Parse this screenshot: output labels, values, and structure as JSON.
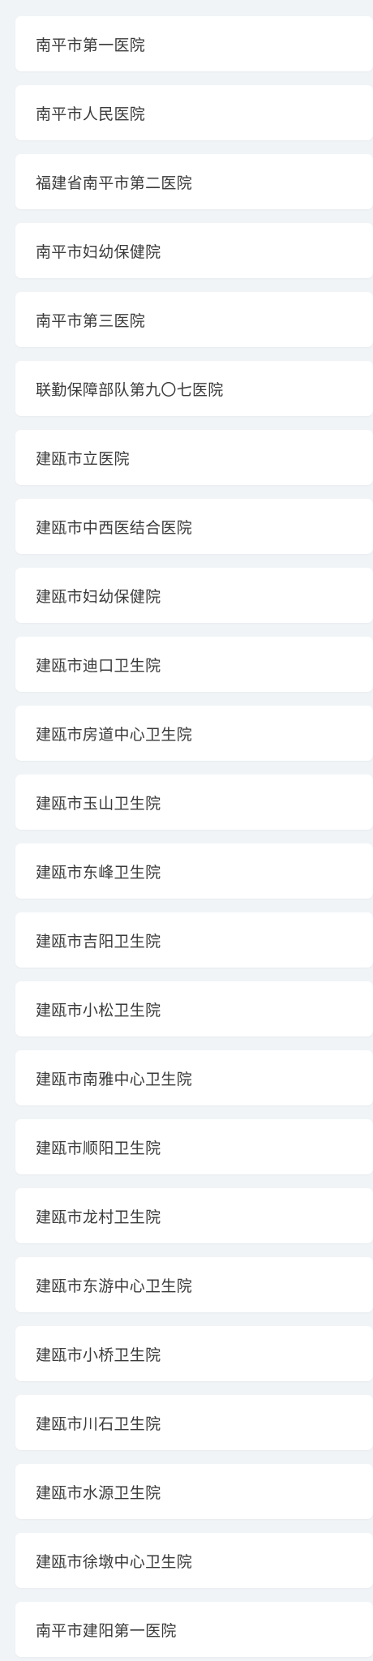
{
  "hospitals": [
    "南平市第一医院",
    "南平市人民医院",
    "福建省南平市第二医院",
    "南平市妇幼保健院",
    "南平市第三医院",
    "联勤保障部队第九〇七医院",
    "建瓯市立医院",
    "建瓯市中西医结合医院",
    "建瓯市妇幼保健院",
    "建瓯市迪口卫生院",
    "建瓯市房道中心卫生院",
    "建瓯市玉山卫生院",
    "建瓯市东峰卫生院",
    "建瓯市吉阳卫生院",
    "建瓯市小松卫生院",
    "建瓯市南雅中心卫生院",
    "建瓯市顺阳卫生院",
    "建瓯市龙村卫生院",
    "建瓯市东游中心卫生院",
    "建瓯市小桥卫生院",
    "建瓯市川石卫生院",
    "建瓯市水源卫生院",
    "建瓯市徐墩中心卫生院",
    "南平市建阳第一医院"
  ]
}
